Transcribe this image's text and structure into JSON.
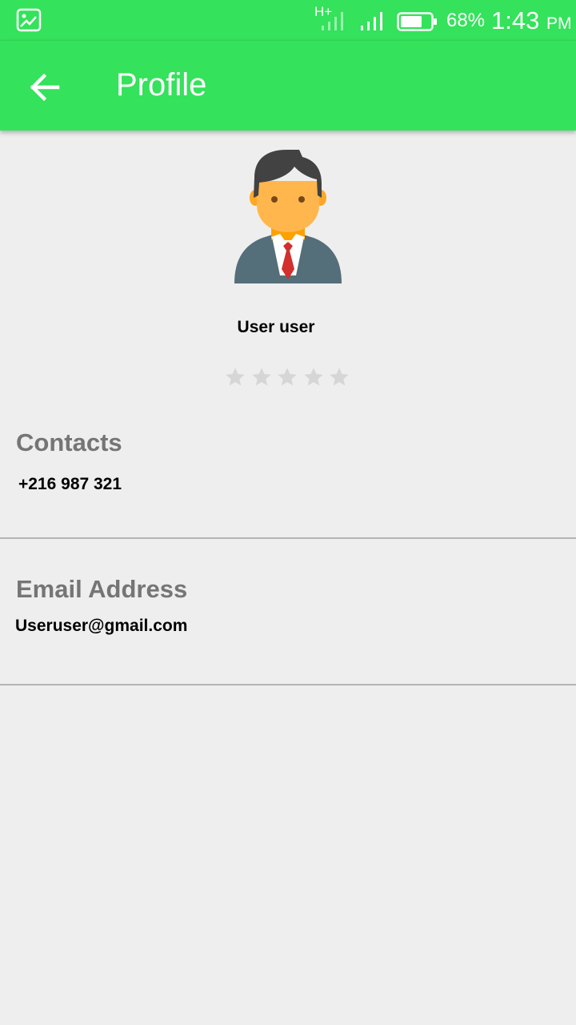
{
  "status_bar": {
    "network_type": "H+",
    "battery_percent": "68%",
    "time": "1:43",
    "ampm": "PM"
  },
  "app_bar": {
    "title": "Profile",
    "back_icon": "arrow-left-icon"
  },
  "profile": {
    "avatar_icon": "user-avatar-icon",
    "name": "User user",
    "rating": {
      "value": 0,
      "max": 5
    }
  },
  "contacts": {
    "title": "Contacts",
    "phone": "+216 987 321"
  },
  "email": {
    "title": "Email Address",
    "address": "Useruser@gmail.com"
  },
  "colors": {
    "accent": "#34e25b",
    "background": "#eeeeee",
    "section_title": "#757575",
    "star_empty": "#d6d6d6",
    "divider": "#b4b4b4"
  }
}
